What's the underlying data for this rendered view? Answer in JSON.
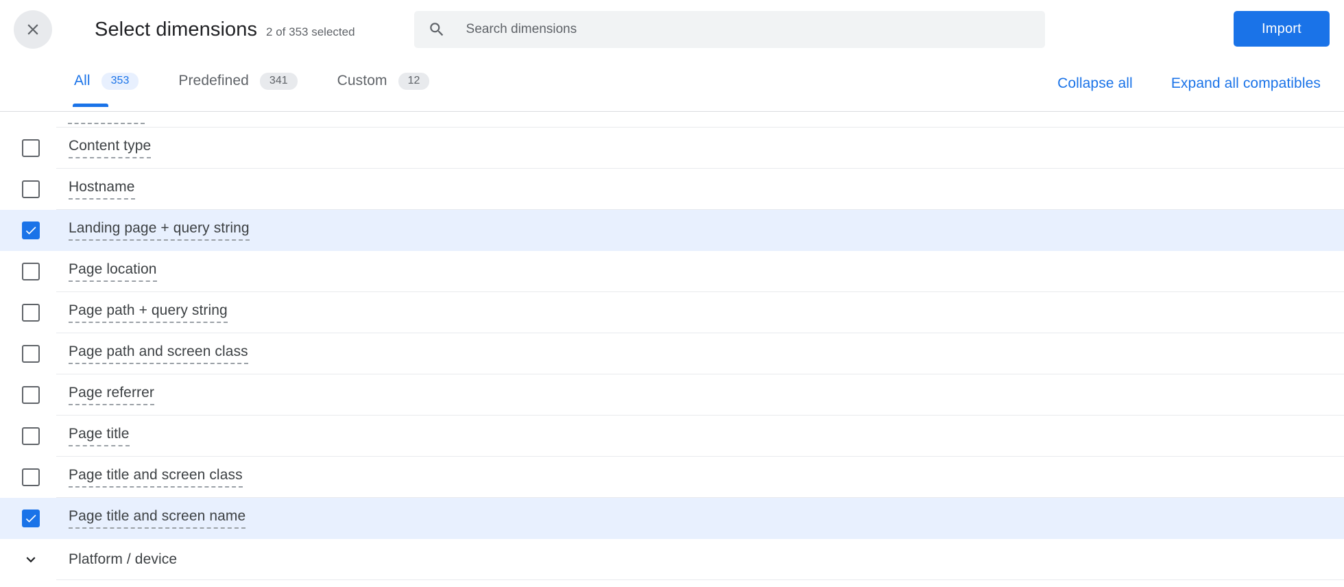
{
  "header": {
    "close_icon": "close-icon",
    "title": "Select dimensions",
    "subtitle": "2 of 353 selected",
    "search": {
      "icon": "search-icon",
      "placeholder": "Search dimensions",
      "value": ""
    },
    "import_label": "Import"
  },
  "tabs": [
    {
      "label": "All",
      "badge": "353",
      "active": true
    },
    {
      "label": "Predefined",
      "badge": "341",
      "active": false
    },
    {
      "label": "Custom",
      "badge": "12",
      "active": false
    }
  ],
  "tab_actions": {
    "collapse_all": "Collapse all",
    "expand_all_compatibles": "Expand all compatibles"
  },
  "rows": [
    {
      "label": "Content type",
      "checked": false,
      "type": "item"
    },
    {
      "label": "Hostname",
      "checked": false,
      "type": "item"
    },
    {
      "label": "Landing page + query string",
      "checked": true,
      "type": "item"
    },
    {
      "label": "Page location",
      "checked": false,
      "type": "item"
    },
    {
      "label": "Page path + query string",
      "checked": false,
      "type": "item"
    },
    {
      "label": "Page path and screen class",
      "checked": false,
      "type": "item"
    },
    {
      "label": "Page referrer",
      "checked": false,
      "type": "item"
    },
    {
      "label": "Page title",
      "checked": false,
      "type": "item"
    },
    {
      "label": "Page title and screen class",
      "checked": false,
      "type": "item"
    },
    {
      "label": "Page title and screen name",
      "checked": true,
      "type": "item"
    },
    {
      "label": "Platform / device",
      "checked": false,
      "type": "group"
    }
  ],
  "colors": {
    "accent": "#1a73e8",
    "selected_row_bg": "#e8f0fe",
    "divider": "#e8eaed",
    "text_primary": "#202124",
    "text_secondary": "#5f6368",
    "search_bg": "#f1f3f4",
    "close_bg": "#e8eaed"
  }
}
